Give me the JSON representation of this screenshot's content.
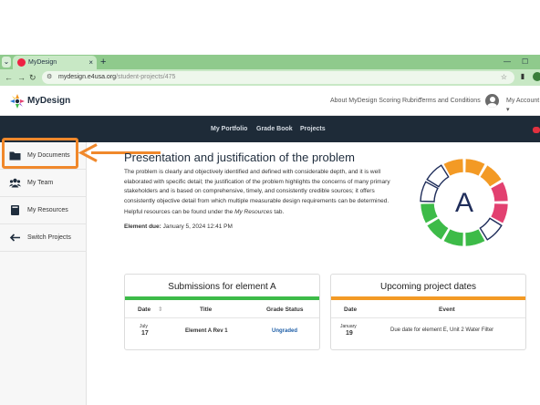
{
  "browser": {
    "tab_title": "MyDesign",
    "tab_close": "×",
    "new_tab": "+",
    "url_domain": "mydesign.e4usa.org",
    "url_path": "/student-projects/475",
    "back": "←",
    "forward": "→",
    "reload": "↻",
    "star": "☆",
    "minimize": "—",
    "maximize": "☐"
  },
  "header": {
    "logo_text": "MyDesign",
    "links": [
      "About MyDesign Scoring Rubric",
      "Terms and Conditions"
    ],
    "account_label": "My Account ▾"
  },
  "nav": {
    "items": [
      "My Portfolio",
      "Grade Book",
      "Projects"
    ]
  },
  "sidebar": {
    "items": [
      {
        "label": "My Documents",
        "icon": "folder-icon"
      },
      {
        "label": "My Team",
        "icon": "team-icon"
      },
      {
        "label": "My Resources",
        "icon": "book-icon"
      },
      {
        "label": "Switch Projects",
        "icon": "arrow-left-icon"
      }
    ]
  },
  "main": {
    "title": "Presentation and justification of the problem",
    "description": "The problem is clearly and objectively identified and defined with considerable depth, and it is well elaborated with specific detail; the justification of the problem highlights the concerns of many primary stakeholders and is based on comprehensive, timely, and consistently credible sources; it offers consistently objective detail from which multiple measurable design requirements can be determined.",
    "help_prefix": "Helpful resources can be found under the ",
    "help_link": "My Resources",
    "help_suffix": " tab.",
    "due_label": "Element due:",
    "due_value": "January 5, 2024 12:41 PM",
    "ring_letter": "A"
  },
  "submissions": {
    "title": "Submissions for element A",
    "accent": "#3dbb48",
    "columns": [
      "Date",
      "Title",
      "Grade Status"
    ],
    "sort_icon": "⇕",
    "rows": [
      {
        "month": "July",
        "day": "17",
        "title": "Element A Rev 1",
        "status": "Ungraded"
      }
    ]
  },
  "upcoming": {
    "title": "Upcoming project dates",
    "accent": "#f39a25",
    "columns": [
      "Date",
      "Event"
    ],
    "rows": [
      {
        "month": "January",
        "day": "19",
        "event": "Due date for element E, Unit 2 Water Filter"
      }
    ]
  },
  "colors": {
    "brand_dark": "#1e2b38",
    "highlight": "#f0882b",
    "link_blue": "#1f5fa8"
  }
}
